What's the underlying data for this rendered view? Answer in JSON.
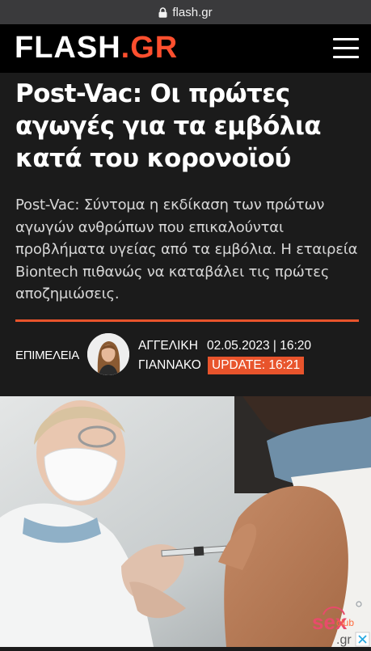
{
  "browser": {
    "url": "flash.gr"
  },
  "site": {
    "logo_main": "FLASH",
    "logo_suffix": ".GR",
    "accent": "#e8542c"
  },
  "article": {
    "headline": "Post-Vac: Οι πρώτες αγωγές για τα εμβόλια κατά του κορονοϊού",
    "lead": "Post-Vac: Σύντομα η εκδίκαση των πρώτων αγωγών ανθρώπων που επικαλούνται προβλήματα υγείας από τα εμβόλια. Η εταιρεία Biontech πιθανώς να καταβάλει τις πρώτες αποζημιώσεις.",
    "byline_label": "ΕΠΙΜΕΛΕΙΑ",
    "author_first": "ΑΓΓΕΛΙΚΗ",
    "author_last": "ΓΙΑΝΝΑΚΟ",
    "date": "02.05.2023 | 16:20",
    "update": "UPDATE: 16:21"
  },
  "watermark": {
    "main": "sex",
    "suffix": "club",
    "tld": ".gr"
  },
  "icons": [
    "lock-icon",
    "hamburger-menu-icon",
    "author-avatar",
    "close-icon"
  ]
}
